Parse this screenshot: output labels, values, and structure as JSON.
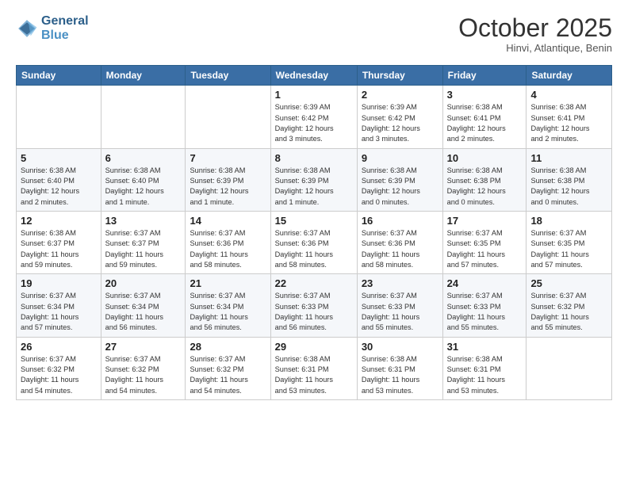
{
  "header": {
    "logo_line1": "General",
    "logo_line2": "Blue",
    "month": "October 2025",
    "location": "Hinvi, Atlantique, Benin"
  },
  "weekdays": [
    "Sunday",
    "Monday",
    "Tuesday",
    "Wednesday",
    "Thursday",
    "Friday",
    "Saturday"
  ],
  "weeks": [
    [
      {
        "day": "",
        "info": ""
      },
      {
        "day": "",
        "info": ""
      },
      {
        "day": "",
        "info": ""
      },
      {
        "day": "1",
        "info": "Sunrise: 6:39 AM\nSunset: 6:42 PM\nDaylight: 12 hours\nand 3 minutes."
      },
      {
        "day": "2",
        "info": "Sunrise: 6:39 AM\nSunset: 6:42 PM\nDaylight: 12 hours\nand 3 minutes."
      },
      {
        "day": "3",
        "info": "Sunrise: 6:38 AM\nSunset: 6:41 PM\nDaylight: 12 hours\nand 2 minutes."
      },
      {
        "day": "4",
        "info": "Sunrise: 6:38 AM\nSunset: 6:41 PM\nDaylight: 12 hours\nand 2 minutes."
      }
    ],
    [
      {
        "day": "5",
        "info": "Sunrise: 6:38 AM\nSunset: 6:40 PM\nDaylight: 12 hours\nand 2 minutes."
      },
      {
        "day": "6",
        "info": "Sunrise: 6:38 AM\nSunset: 6:40 PM\nDaylight: 12 hours\nand 1 minute."
      },
      {
        "day": "7",
        "info": "Sunrise: 6:38 AM\nSunset: 6:39 PM\nDaylight: 12 hours\nand 1 minute."
      },
      {
        "day": "8",
        "info": "Sunrise: 6:38 AM\nSunset: 6:39 PM\nDaylight: 12 hours\nand 1 minute."
      },
      {
        "day": "9",
        "info": "Sunrise: 6:38 AM\nSunset: 6:39 PM\nDaylight: 12 hours\nand 0 minutes."
      },
      {
        "day": "10",
        "info": "Sunrise: 6:38 AM\nSunset: 6:38 PM\nDaylight: 12 hours\nand 0 minutes."
      },
      {
        "day": "11",
        "info": "Sunrise: 6:38 AM\nSunset: 6:38 PM\nDaylight: 12 hours\nand 0 minutes."
      }
    ],
    [
      {
        "day": "12",
        "info": "Sunrise: 6:38 AM\nSunset: 6:37 PM\nDaylight: 11 hours\nand 59 minutes."
      },
      {
        "day": "13",
        "info": "Sunrise: 6:37 AM\nSunset: 6:37 PM\nDaylight: 11 hours\nand 59 minutes."
      },
      {
        "day": "14",
        "info": "Sunrise: 6:37 AM\nSunset: 6:36 PM\nDaylight: 11 hours\nand 58 minutes."
      },
      {
        "day": "15",
        "info": "Sunrise: 6:37 AM\nSunset: 6:36 PM\nDaylight: 11 hours\nand 58 minutes."
      },
      {
        "day": "16",
        "info": "Sunrise: 6:37 AM\nSunset: 6:36 PM\nDaylight: 11 hours\nand 58 minutes."
      },
      {
        "day": "17",
        "info": "Sunrise: 6:37 AM\nSunset: 6:35 PM\nDaylight: 11 hours\nand 57 minutes."
      },
      {
        "day": "18",
        "info": "Sunrise: 6:37 AM\nSunset: 6:35 PM\nDaylight: 11 hours\nand 57 minutes."
      }
    ],
    [
      {
        "day": "19",
        "info": "Sunrise: 6:37 AM\nSunset: 6:34 PM\nDaylight: 11 hours\nand 57 minutes."
      },
      {
        "day": "20",
        "info": "Sunrise: 6:37 AM\nSunset: 6:34 PM\nDaylight: 11 hours\nand 56 minutes."
      },
      {
        "day": "21",
        "info": "Sunrise: 6:37 AM\nSunset: 6:34 PM\nDaylight: 11 hours\nand 56 minutes."
      },
      {
        "day": "22",
        "info": "Sunrise: 6:37 AM\nSunset: 6:33 PM\nDaylight: 11 hours\nand 56 minutes."
      },
      {
        "day": "23",
        "info": "Sunrise: 6:37 AM\nSunset: 6:33 PM\nDaylight: 11 hours\nand 55 minutes."
      },
      {
        "day": "24",
        "info": "Sunrise: 6:37 AM\nSunset: 6:33 PM\nDaylight: 11 hours\nand 55 minutes."
      },
      {
        "day": "25",
        "info": "Sunrise: 6:37 AM\nSunset: 6:32 PM\nDaylight: 11 hours\nand 55 minutes."
      }
    ],
    [
      {
        "day": "26",
        "info": "Sunrise: 6:37 AM\nSunset: 6:32 PM\nDaylight: 11 hours\nand 54 minutes."
      },
      {
        "day": "27",
        "info": "Sunrise: 6:37 AM\nSunset: 6:32 PM\nDaylight: 11 hours\nand 54 minutes."
      },
      {
        "day": "28",
        "info": "Sunrise: 6:37 AM\nSunset: 6:32 PM\nDaylight: 11 hours\nand 54 minutes."
      },
      {
        "day": "29",
        "info": "Sunrise: 6:38 AM\nSunset: 6:31 PM\nDaylight: 11 hours\nand 53 minutes."
      },
      {
        "day": "30",
        "info": "Sunrise: 6:38 AM\nSunset: 6:31 PM\nDaylight: 11 hours\nand 53 minutes."
      },
      {
        "day": "31",
        "info": "Sunrise: 6:38 AM\nSunset: 6:31 PM\nDaylight: 11 hours\nand 53 minutes."
      },
      {
        "day": "",
        "info": ""
      }
    ]
  ]
}
